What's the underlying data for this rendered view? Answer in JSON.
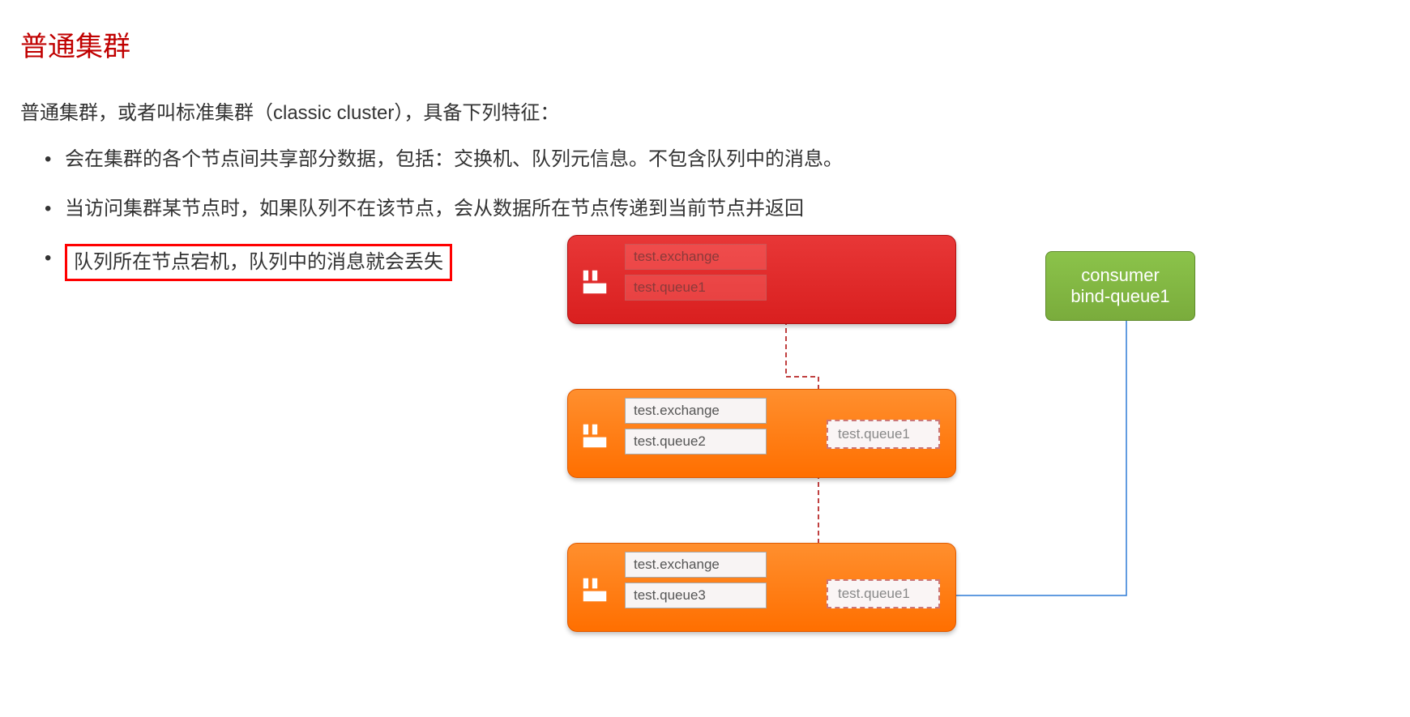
{
  "title": "普通集群",
  "intro": "普通集群，或者叫标准集群（classic cluster），具备下列特征：",
  "bullets": [
    "会在集群的各个节点间共享部分数据，包括：交换机、队列元信息。不包含队列中的消息。",
    "当访问集群某节点时，如果队列不在该节点，会从数据所在节点传递到当前节点并返回",
    "队列所在节点宕机，队列中的消息就会丢失"
  ],
  "nodes": {
    "n1": {
      "exchange": "test.exchange",
      "queue": "test.queue1"
    },
    "n2": {
      "exchange": "test.exchange",
      "queue": "test.queue2",
      "ghost": "test.queue1"
    },
    "n3": {
      "exchange": "test.exchange",
      "queue": "test.queue3",
      "ghost": "test.queue1"
    }
  },
  "consumer": {
    "line1": "consumer",
    "line2": "bind-queue1"
  },
  "colors": {
    "red": "#d91f1f",
    "orange": "#ff6f00",
    "green": "#7aac3c",
    "highlight_border": "#ff0000",
    "dashed_line": "#c04040",
    "solid_line": "#2e7cd6"
  }
}
